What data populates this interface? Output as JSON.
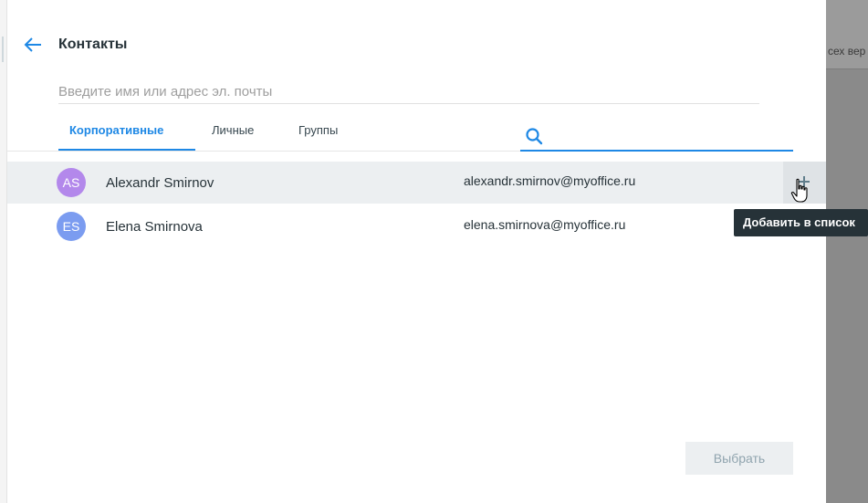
{
  "background_app": {
    "partial_text": "сех вер"
  },
  "dialog": {
    "title": "Контакты",
    "search": {
      "placeholder": "Введите имя или адрес эл. почты",
      "value": ""
    },
    "tabs": [
      {
        "label": "Корпоративные",
        "active": true
      },
      {
        "label": "Личные",
        "active": false
      },
      {
        "label": "Группы",
        "active": false
      }
    ],
    "filter": {
      "icon": "search-icon",
      "value": ""
    },
    "contacts": [
      {
        "initials": "AS",
        "name": "Alexandr Smirnov",
        "email": "alexandr.smirnov@myoffice.ru",
        "avatar_color": "#b388eb",
        "hovered": true
      },
      {
        "initials": "ES",
        "name": "Elena Smirnova",
        "email": "elena.smirnova@myoffice.ru",
        "avatar_color": "#7b9cf0",
        "hovered": false
      }
    ],
    "add_button_icon": "plus-icon",
    "tooltip": "Добавить в список",
    "select_button": "Выбрать"
  },
  "colors": {
    "accent": "#1e88e5",
    "tooltip_bg": "#263238",
    "hover_row": "#eceff1",
    "overlay": "#8a8a8a"
  }
}
